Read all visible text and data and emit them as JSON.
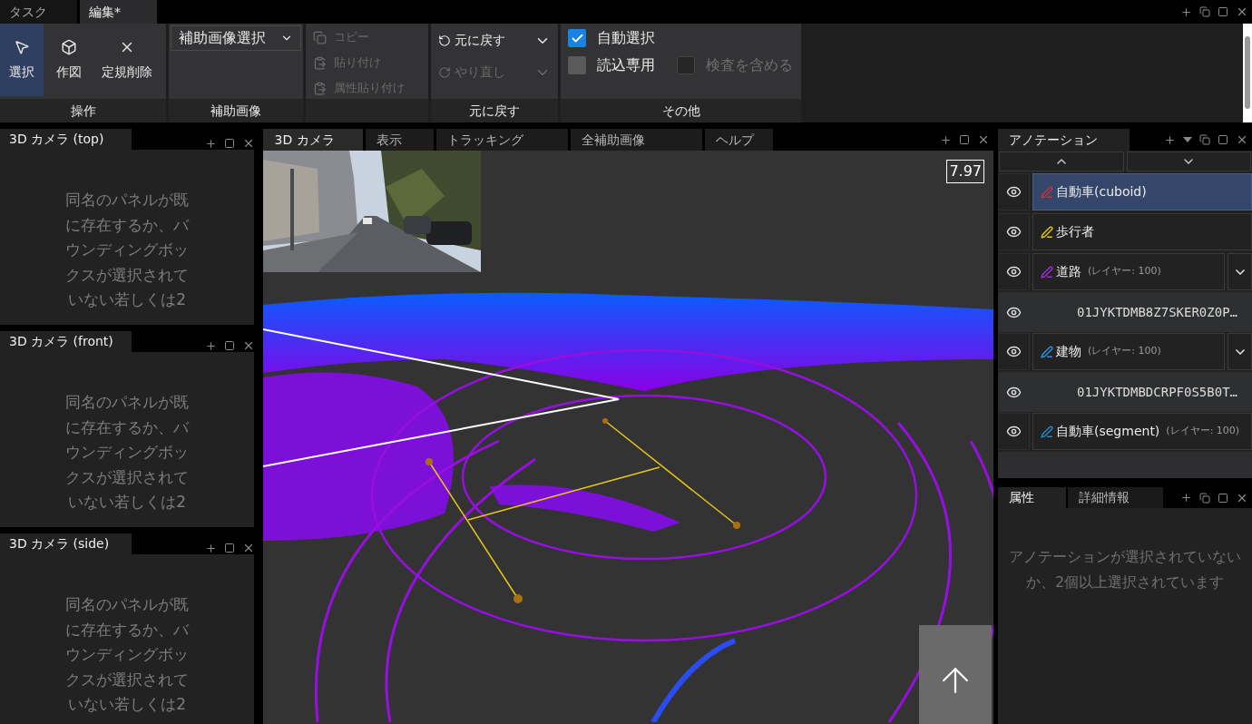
{
  "top_tabs": [
    {
      "label": "タスク",
      "selected": false
    },
    {
      "label": "編集*",
      "selected": true
    }
  ],
  "ribbon": {
    "groups": [
      {
        "kind": "tools",
        "label": "操作",
        "items": [
          {
            "label": "選択",
            "selected": true
          },
          {
            "label": "作図",
            "selected": false
          },
          {
            "label": "定規削除",
            "selected": false
          }
        ]
      },
      {
        "kind": "dropdown",
        "label": "補助画像",
        "value": "補助画像選択"
      },
      {
        "kind": "clipboard",
        "items": [
          {
            "label": "コピー",
            "disabled": true
          },
          {
            "label": "貼り付け",
            "disabled": true
          },
          {
            "label": "属性貼り付け",
            "disabled": true
          }
        ]
      },
      {
        "kind": "undo",
        "label": "元に戻す",
        "items": [
          {
            "label": "元に戻す",
            "disabled": false
          },
          {
            "label": "やり直し",
            "disabled": true
          }
        ]
      },
      {
        "kind": "options",
        "label": "その他",
        "items": [
          {
            "label": "自動選択",
            "checked": true,
            "disabled": false
          },
          {
            "label": "読込専用",
            "checked": false,
            "disabled": false
          },
          {
            "label": "検査を含める",
            "checked": false,
            "disabled": true
          }
        ]
      }
    ]
  },
  "left_panels": [
    {
      "title": "3D カメラ (top)",
      "message": "同名のパネルが既に存在するか、バウンディングボックスが選択されていない若しくは2"
    },
    {
      "title": "3D カメラ (front)",
      "message": "同名のパネルが既に存在するか、バウンディングボックスが選択されていない若しくは2"
    },
    {
      "title": "3D カメラ (side)",
      "message": "同名のパネルが既に存在するか、バウンディングボックスが選択されていない若しくは2"
    }
  ],
  "viewport": {
    "tabs": [
      {
        "label": "3D カメラ",
        "selected": true
      },
      {
        "label": "表示",
        "selected": false
      },
      {
        "label": "トラッキング",
        "selected": false
      },
      {
        "label": "全補助画像",
        "selected": false
      },
      {
        "label": "ヘルプ",
        "selected": false
      }
    ],
    "scale": "7.97"
  },
  "annotations": {
    "title": "アノテーション",
    "items": [
      {
        "kind": "class",
        "label": "自動車(cuboid)",
        "color": "#c2353a",
        "selected": true
      },
      {
        "kind": "class",
        "label": "歩行者",
        "color": "#e0c21a",
        "selected": false
      },
      {
        "kind": "class",
        "label": "道路",
        "layer": "(レイヤー: 100)",
        "color": "#9b2fd6",
        "selected": false,
        "expandable": true
      },
      {
        "kind": "instance",
        "label": "01JYKTDMB8Z7SKER0Z0P…",
        "selected": false
      },
      {
        "kind": "class",
        "label": "建物",
        "layer": "(レイヤー: 100)",
        "color": "#2f8de0",
        "selected": false,
        "expandable": true
      },
      {
        "kind": "instance",
        "label": "01JYKTDMBDCRPF0S5B0T…",
        "selected": false
      },
      {
        "kind": "class",
        "label": "自動車(segment)",
        "layer": "(レイヤー: 100)",
        "color": "#2a86c8",
        "selected": false
      }
    ]
  },
  "attributes": {
    "tabs": [
      {
        "label": "属性",
        "selected": true
      },
      {
        "label": "詳細情報",
        "selected": false
      }
    ],
    "message": "アノテーションが選択されていないか、2個以上選択されています"
  }
}
